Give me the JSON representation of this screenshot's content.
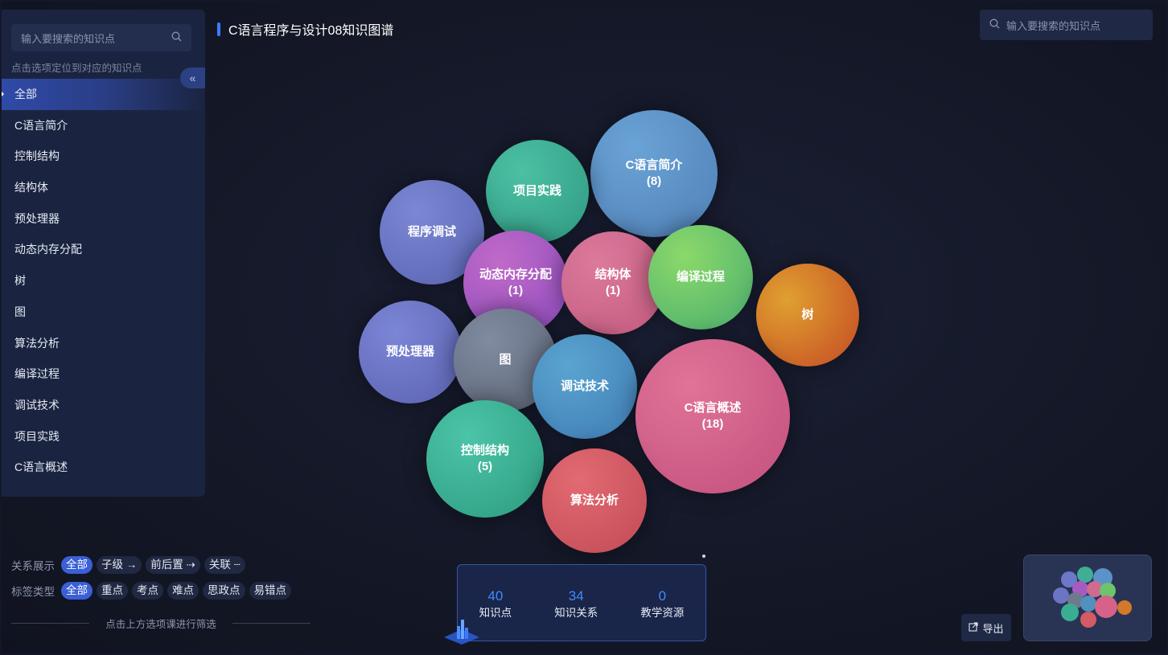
{
  "header": {
    "title": "C语言程序与设计08知识图谱",
    "search_placeholder": "输入要搜索的知识点"
  },
  "sidebar": {
    "search_placeholder": "输入要搜索的知识点",
    "hint": "点击选项定位到对应的知识点",
    "collapse_label": "«",
    "items": [
      {
        "label": "全部"
      },
      {
        "label": "C语言简介"
      },
      {
        "label": "控制结构"
      },
      {
        "label": "结构体"
      },
      {
        "label": "预处理器"
      },
      {
        "label": "动态内存分配"
      },
      {
        "label": "树"
      },
      {
        "label": "图"
      },
      {
        "label": "算法分析"
      },
      {
        "label": "编译过程"
      },
      {
        "label": "调试技术"
      },
      {
        "label": "项目实践"
      },
      {
        "label": "C语言概述"
      }
    ]
  },
  "bubbles": [
    {
      "label": "C语言简介",
      "count": "(8)",
      "color": "#5b92c8"
    },
    {
      "label": "项目实践",
      "count": "",
      "color": "#3fae94"
    },
    {
      "label": "程序调试",
      "count": "",
      "color": "#6e78c8"
    },
    {
      "label": "动态内存分配",
      "count": "(1)",
      "color": "#a55bc2"
    },
    {
      "label": "结构体",
      "count": "(1)",
      "color": "#d06b8f"
    },
    {
      "label": "编译过程",
      "count": "",
      "color": "#6cc46c"
    },
    {
      "label": "树",
      "count": "",
      "color": "#d27a2a"
    },
    {
      "label": "预处理器",
      "count": "",
      "color": "#6a76c4"
    },
    {
      "label": "图",
      "count": "",
      "color": "#6f7a8e"
    },
    {
      "label": "调试技术",
      "count": "",
      "color": "#4f92c0"
    },
    {
      "label": "C语言概述",
      "count": "(18)",
      "color": "#d6628a"
    },
    {
      "label": "控制结构",
      "count": "(5)",
      "color": "#3aae93"
    },
    {
      "label": "算法分析",
      "count": "",
      "color": "#d45a64"
    }
  ],
  "filters": {
    "relation_label": "关系展示",
    "relation_chips": [
      "全部",
      "子级 →",
      "前后置 ⇢",
      "关联 ┈"
    ],
    "tag_label": "标签类型",
    "tag_chips": [
      "全部",
      "重点",
      "考点",
      "难点",
      "思政点",
      "易错点"
    ],
    "footer_hint": "点击上方选项课进行筛选"
  },
  "stats": [
    {
      "value": "40",
      "name": "知识点"
    },
    {
      "value": "34",
      "name": "知识关系"
    },
    {
      "value": "0",
      "name": "教学资源"
    }
  ],
  "export_label": "导出",
  "colors": {
    "accent": "#3d7bff",
    "active_chip": "#3a5fd6",
    "panel": "#1a2440"
  }
}
